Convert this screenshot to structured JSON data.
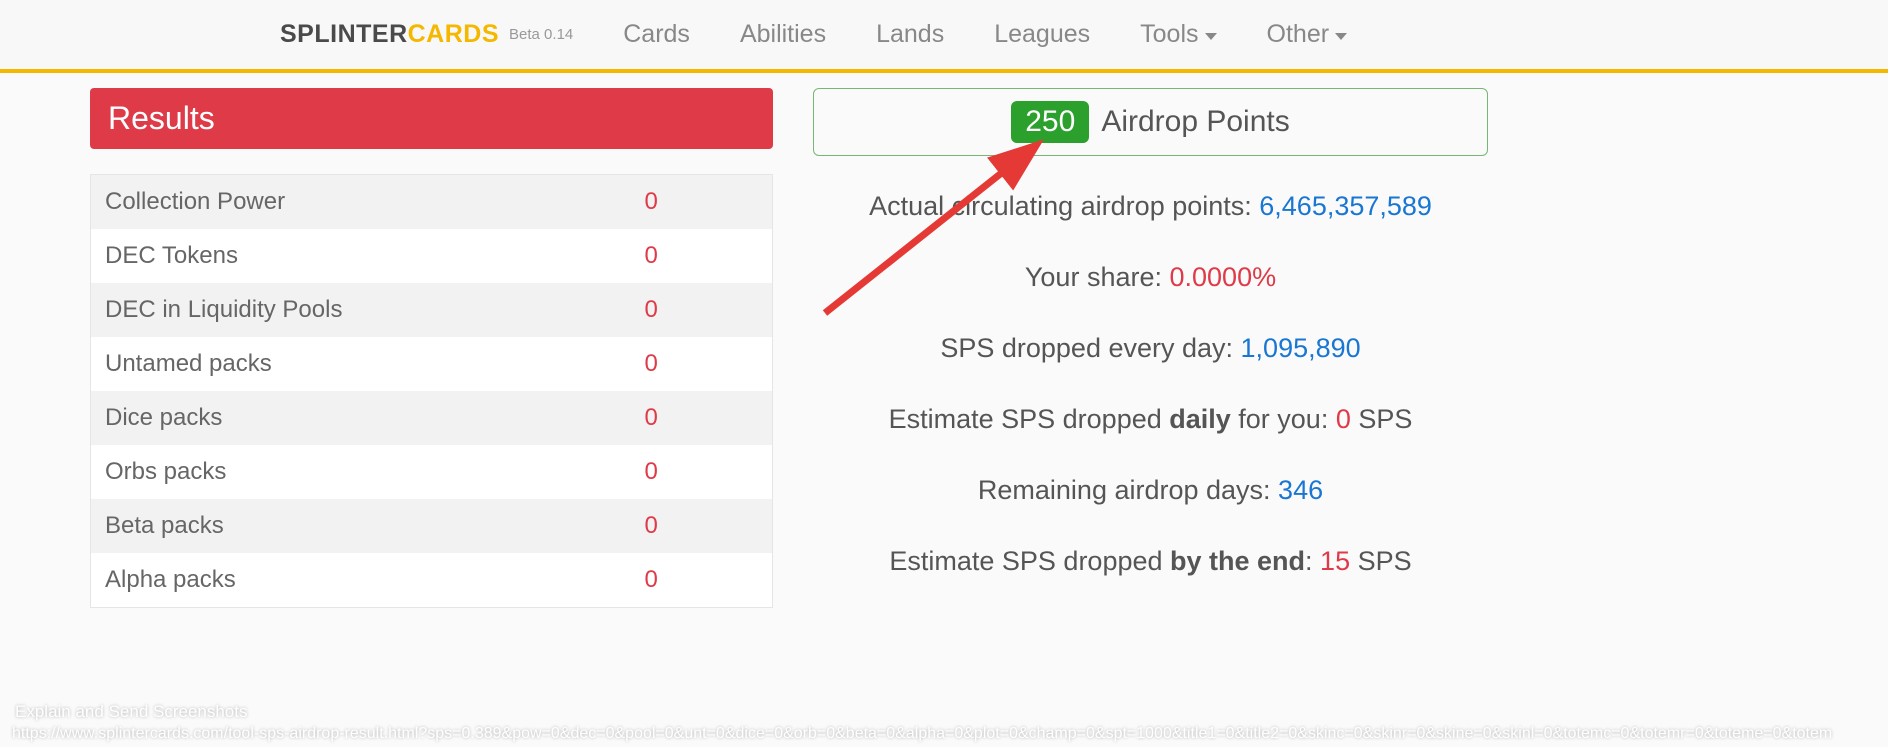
{
  "logo": {
    "part1": "SPLINTER",
    "part2": "CARDS",
    "beta": "Beta 0.14"
  },
  "nav": {
    "cards": "Cards",
    "abilities": "Abilities",
    "lands": "Lands",
    "leagues": "Leagues",
    "tools": "Tools",
    "other": "Other"
  },
  "results": {
    "header": "Results",
    "rows": [
      {
        "label": "Collection Power",
        "value": "0"
      },
      {
        "label": "DEC Tokens",
        "value": "0"
      },
      {
        "label": "DEC in Liquidity Pools",
        "value": "0"
      },
      {
        "label": "Untamed packs",
        "value": "0"
      },
      {
        "label": "Dice packs",
        "value": "0"
      },
      {
        "label": "Orbs packs",
        "value": "0"
      },
      {
        "label": "Beta packs",
        "value": "0"
      },
      {
        "label": "Alpha packs",
        "value": "0"
      }
    ]
  },
  "airdrop": {
    "badge": "250",
    "label": "Airdrop Points"
  },
  "stats": {
    "circulating_label": "Actual circulating airdrop points: ",
    "circulating_value": "6,465,357,589",
    "share_label": "Your share: ",
    "share_value": "0.0000%",
    "sps_daily_label": "SPS dropped every day: ",
    "sps_daily_value": "1,095,890",
    "estimate_daily_prefix": "Estimate SPS dropped ",
    "estimate_daily_bold": "daily",
    "estimate_daily_mid": " for you: ",
    "estimate_daily_value": "0",
    "estimate_daily_suffix": " SPS",
    "remaining_label": "Remaining airdrop days: ",
    "remaining_value": "346",
    "estimate_end_prefix": "Estimate SPS dropped ",
    "estimate_end_bold": "by the end",
    "estimate_end_mid": ": ",
    "estimate_end_value": "15",
    "estimate_end_suffix": " SPS"
  },
  "overlay": {
    "line1": "Explain and Send Screenshots",
    "line2": "https://www.splintercards.com/tool-sps-airdrop-result.html?sps=0.389&pow=0&dec=0&pool=0&unt=0&dice=0&orb=0&beta=0&alpha=0&plot=0&champ=0&spt=1000&title1=0&title2=0&skinc=0&skinr=0&skine=0&skinl=0&totemc=0&totemr=0&toteme=0&totem"
  }
}
